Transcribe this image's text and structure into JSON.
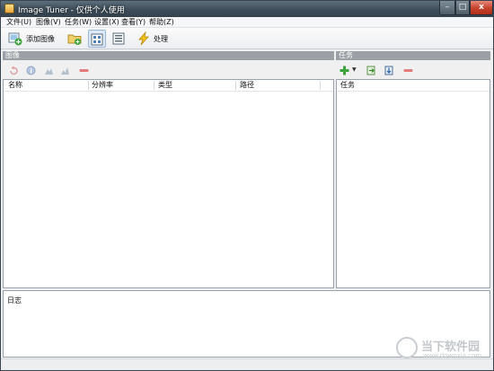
{
  "window": {
    "title": "Image Tuner - 仅供个人使用",
    "controls": {
      "minimize": "–",
      "maximize": "□",
      "close": "x"
    }
  },
  "menu": {
    "items": [
      "文件(U)",
      "图像(V)",
      "任务(W)",
      "设置(X)",
      "查看(Y)",
      "帮助(Z)"
    ]
  },
  "toolbar": {
    "add_images_label": "添加图像",
    "process_label": "处理"
  },
  "images_panel": {
    "header": "图像",
    "columns": [
      "名称",
      "分辨率",
      "类型",
      "路径"
    ]
  },
  "tasks_panel": {
    "header": "任务",
    "columns": [
      "任务"
    ],
    "dropdown_arrow": "▼"
  },
  "log_panel": {
    "label": "日志"
  },
  "watermark": {
    "text": "当下软件园",
    "sub": "www.downxia.com"
  },
  "colors": {
    "section_header": "#9aa0a6",
    "titlebar": "#3e4e5a",
    "close_button": "#c5412a",
    "accent_green": "#3aa33a",
    "remove_red": "#d9534f"
  }
}
